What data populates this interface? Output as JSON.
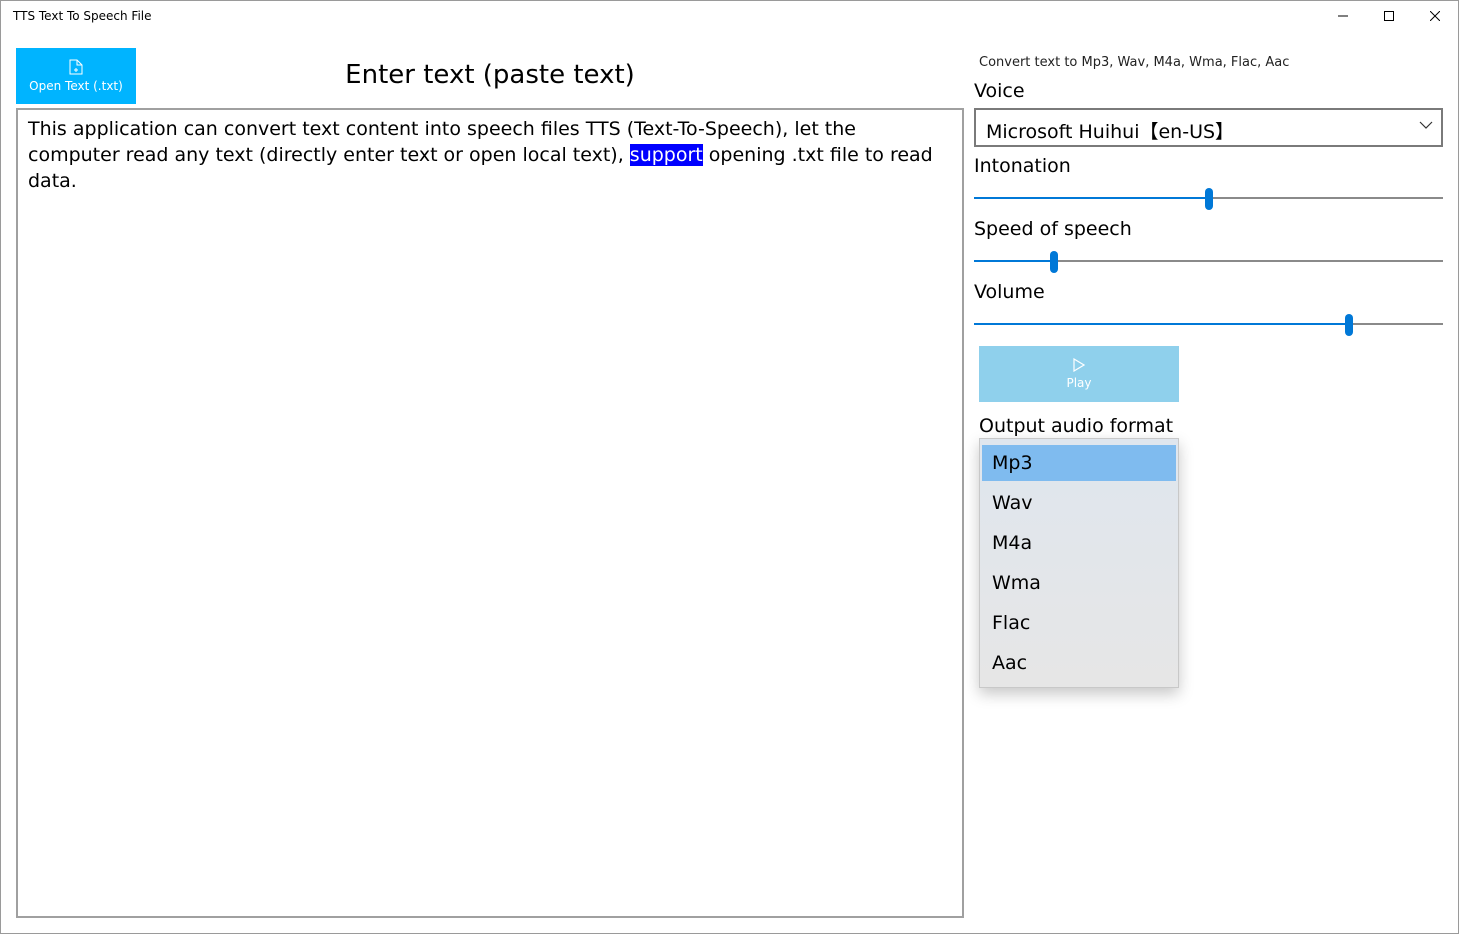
{
  "window": {
    "title": "TTS Text To Speech File"
  },
  "toolbar": {
    "open_label": "Open Text (.txt)"
  },
  "editor": {
    "title": "Enter text (paste text)",
    "text_before": "This application can convert text content into speech files TTS (Text-To-Speech), let the computer read any text (directly enter text or open local text), ",
    "text_selected": "support",
    "text_after": " opening .txt file to read data."
  },
  "settings": {
    "subtitle": "Convert text to Mp3, Wav, M4a, Wma, Flac, Aac",
    "voice_label": "Voice",
    "voice_value": "Microsoft Huihui【en-US】",
    "intonation_label": "Intonation",
    "intonation_value": 0.5,
    "speed_label": "Speed of speech",
    "speed_value": 0.17,
    "volume_label": "Volume",
    "volume_value": 0.8,
    "play_label": "Play",
    "output_label": "Output audio format"
  },
  "formats": [
    "Mp3",
    "Wav",
    "M4a",
    "Wma",
    "Flac",
    "Aac"
  ],
  "selected_format": "Mp3",
  "colors": {
    "accent": "#0078d7",
    "open_button": "#00b4ff",
    "play_button": "#8fd0ec",
    "selection": "#0000ff",
    "dropdown_highlight": "#7fbbef"
  },
  "icons": {
    "open": "file-icon",
    "play": "play-icon",
    "voice_dropdown": "chevron-down-icon"
  }
}
